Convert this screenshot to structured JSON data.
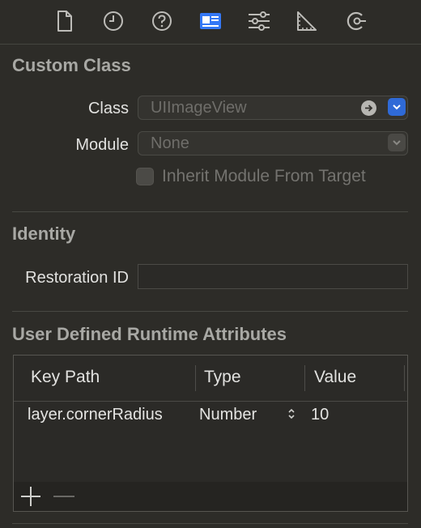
{
  "toolbar": {
    "icons": [
      "file-icon",
      "history-icon",
      "help-icon",
      "identity-icon",
      "attributes-icon",
      "size-icon",
      "connections-icon"
    ],
    "active": "identity-icon",
    "accent_color": "#3478f6"
  },
  "custom_class": {
    "title": "Custom Class",
    "class_label": "Class",
    "class_placeholder": "UIImageView",
    "module_label": "Module",
    "module_placeholder": "None",
    "inherit_label": "Inherit Module From Target",
    "inherit_checked": false
  },
  "identity": {
    "title": "Identity",
    "restoration_label": "Restoration ID",
    "restoration_value": ""
  },
  "runtime_attributes": {
    "title": "User Defined Runtime Attributes",
    "columns": [
      "Key Path",
      "Type",
      "Value"
    ],
    "rows": [
      {
        "key_path": "layer.cornerRadius",
        "type": "Number",
        "value": "10"
      }
    ]
  }
}
